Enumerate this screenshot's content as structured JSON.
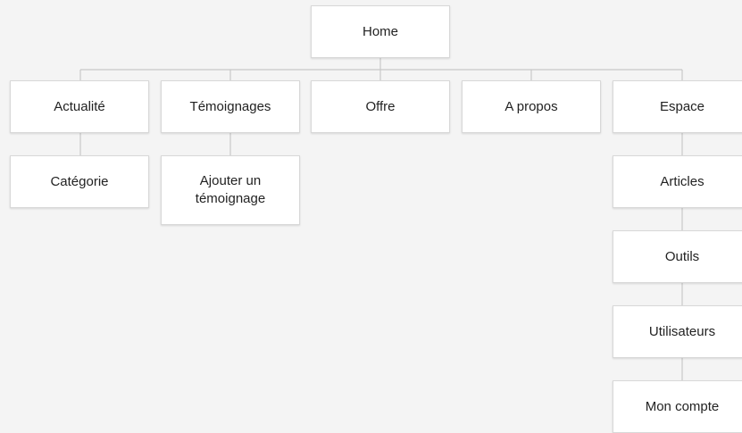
{
  "sitemap": {
    "root": {
      "label": "Home"
    },
    "sections": [
      {
        "label": "Actualité",
        "children": [
          {
            "label": "Catégorie"
          }
        ]
      },
      {
        "label": "Témoignages",
        "children": [
          {
            "label": "Ajouter un témoignage"
          }
        ]
      },
      {
        "label": "Offre",
        "children": []
      },
      {
        "label": "A propos",
        "children": []
      },
      {
        "label": "Espace",
        "children": [
          {
            "label": "Articles"
          },
          {
            "label": "Outils"
          },
          {
            "label": "Utilisateurs"
          },
          {
            "label": "Mon compte"
          }
        ]
      }
    ]
  },
  "colors": {
    "background": "#f4f4f4",
    "node_fill": "#ffffff",
    "node_border": "#d8d8d8",
    "connector": "#c8c8c8",
    "text": "#222222"
  }
}
